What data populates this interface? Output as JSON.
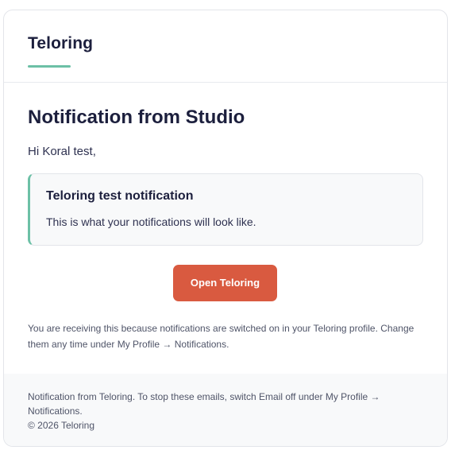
{
  "header": {
    "brand": "Teloring"
  },
  "main": {
    "title": "Notification from Studio",
    "greeting": "Hi Koral test,",
    "notice": {
      "title": "Teloring test notification",
      "body": "This is what your notifications will look like."
    },
    "cta_label": "Open Teloring",
    "info": "You are receiving this because notifications are switched on in your Teloring profile. Change them any time under My Profile → Notifications."
  },
  "footer": {
    "text": "Notification from Teloring. To stop these emails, switch Email off under My Profile → Notifications.",
    "copyright": "© 2026 Teloring"
  },
  "colors": {
    "accent": "#6cc0a6",
    "button": "#d95a40",
    "heading": "#1c1f3d"
  }
}
